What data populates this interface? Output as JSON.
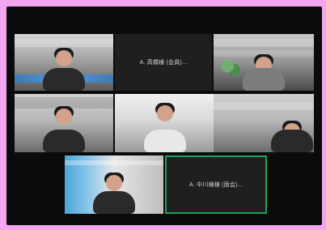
{
  "tiles": {
    "t2_label": "A. 高橋様 (会員)...",
    "t8_label": "A. 中川様様 (面会)..."
  }
}
